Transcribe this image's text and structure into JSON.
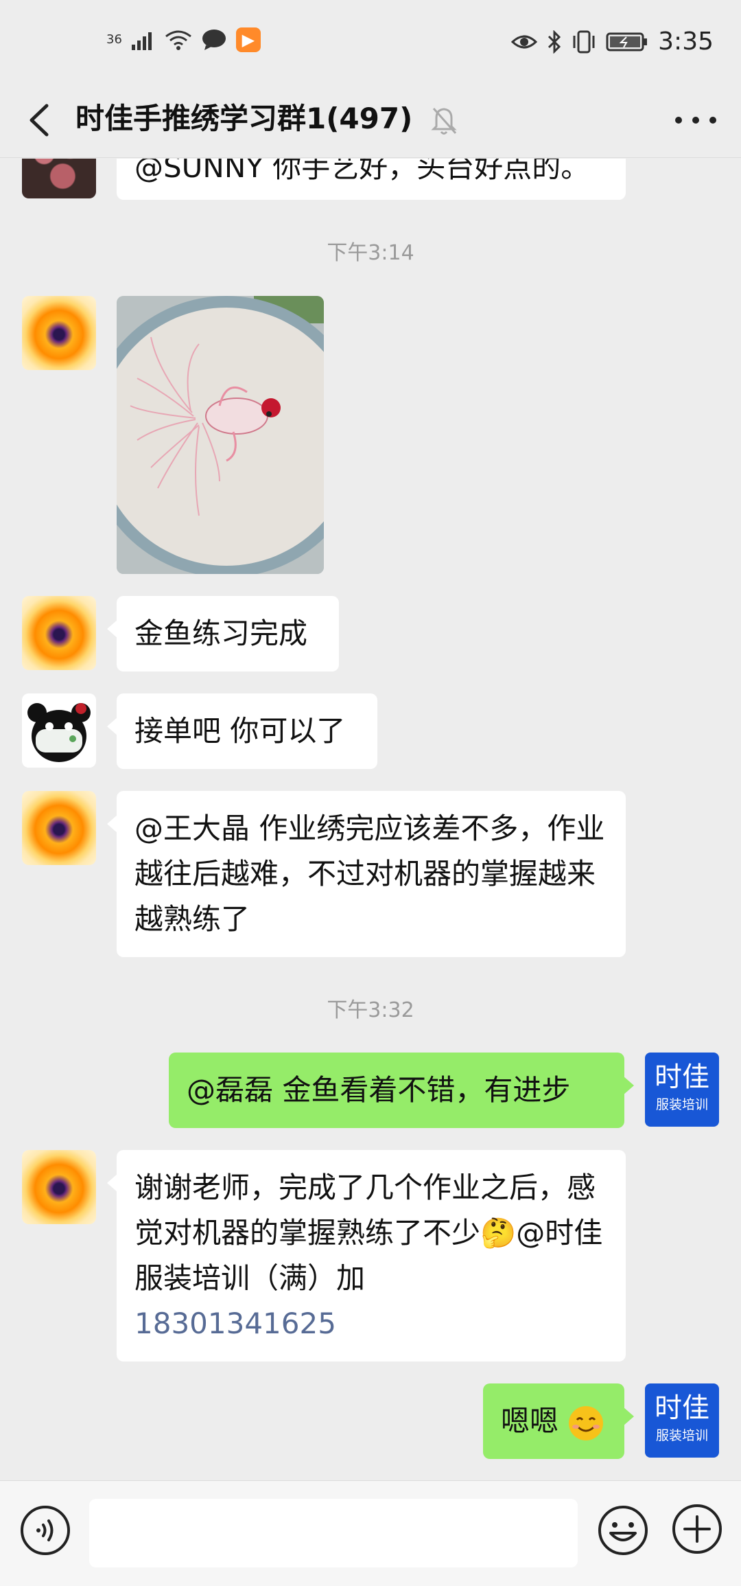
{
  "status_bar": {
    "network": "36",
    "time": "3:35"
  },
  "header": {
    "title": "时佳手推绣学习群1(497)"
  },
  "messages": {
    "partial_text": "@SUNNY  你手艺好，头台好点的。",
    "timestamp_1": "下午3:14",
    "image_watermark": "",
    "msg_goldfish": "金鱼练习完成",
    "msg_takeorders": "接单吧 你可以了",
    "msg_homework": "@王大晶  作业绣完应该差不多，作业越往后越难，不过对机器的掌握越来越熟练了",
    "timestamp_2": "下午3:32",
    "self_msg_1": "@磊磊  金鱼看着不错，有进步",
    "self_avatar_big": "时佳",
    "self_avatar_small": "服装培训",
    "msg_thanks_text": "谢谢老师，完成了几个作业之后，感觉对机器的掌握熟练了不少🤔@时佳服装培训（满）加",
    "msg_thanks_link": "18301341625",
    "self_msg_2": "嗯嗯"
  },
  "colors": {
    "background": "#ededed",
    "self_bubble": "#95ec69",
    "other_bubble": "#ffffff",
    "link": "#576b95",
    "self_avatar_bg": "#1857d6"
  },
  "icons": {
    "back": "chevron-left-icon",
    "mute": "bell-off-icon",
    "more": "more-dots-icon",
    "voice": "voice-icon",
    "emoji": "emoji-icon",
    "plus": "plus-icon"
  }
}
